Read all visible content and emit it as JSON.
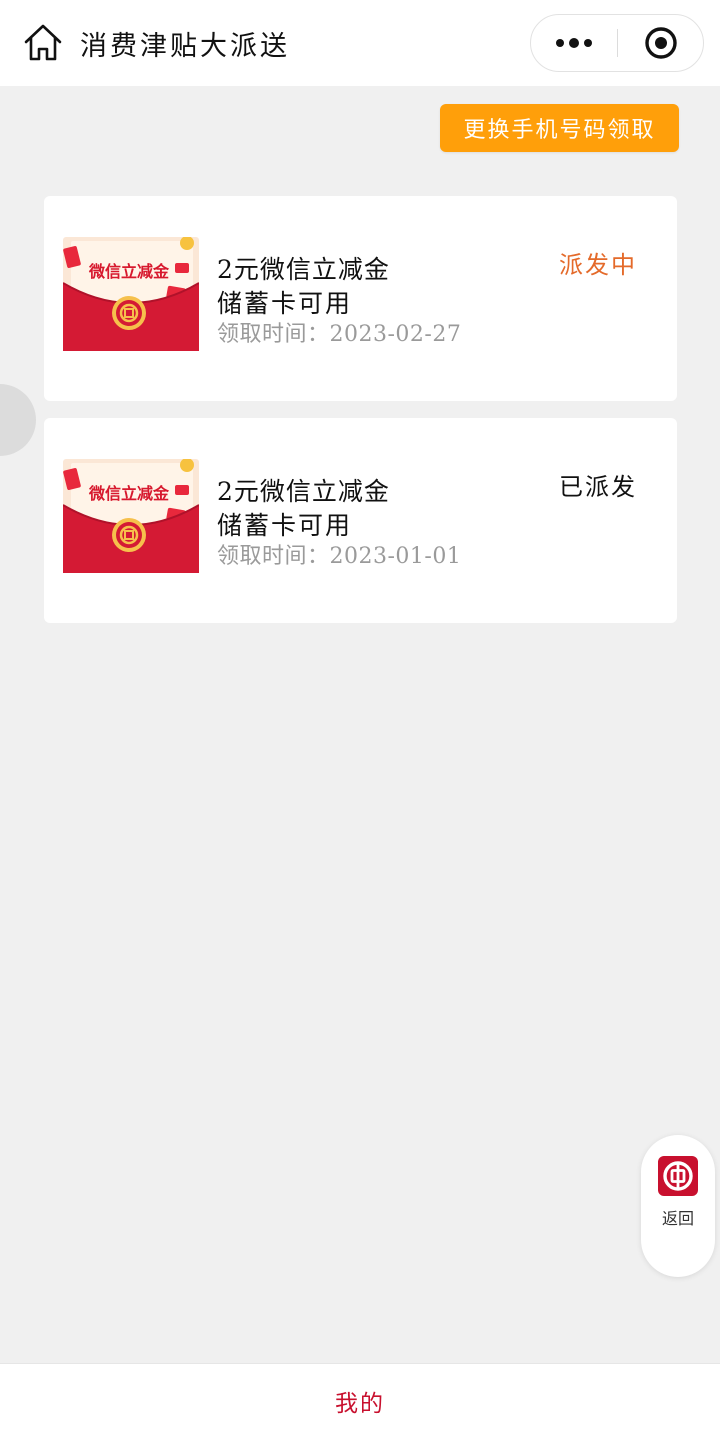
{
  "header": {
    "title": "消费津贴大派送",
    "home_icon": "home-icon",
    "more_icon": "more-dots-icon",
    "close_icon": "target-circle-icon"
  },
  "actions": {
    "change_phone": "更换手机号码领取",
    "change_phone_color": "#ff9f0a"
  },
  "vouchers": [
    {
      "thumb_text": "微信立减金",
      "name": "2元微信立减金",
      "sub": "储蓄卡可用",
      "time": "领取时间：2023-02-27",
      "status": "派发中",
      "status_color": "#e46a2a"
    },
    {
      "thumb_text": "微信立减金",
      "name": "2元微信立减金",
      "sub": "储蓄卡可用",
      "time": "领取时间：2023-01-01",
      "status": "已派发",
      "status_color": "#111111"
    }
  ],
  "float_back": {
    "label": "返回",
    "icon": "bank-logo-icon",
    "brand_color": "#c8102e"
  },
  "bottom_nav": {
    "label": "我的",
    "color": "#c8102e"
  }
}
